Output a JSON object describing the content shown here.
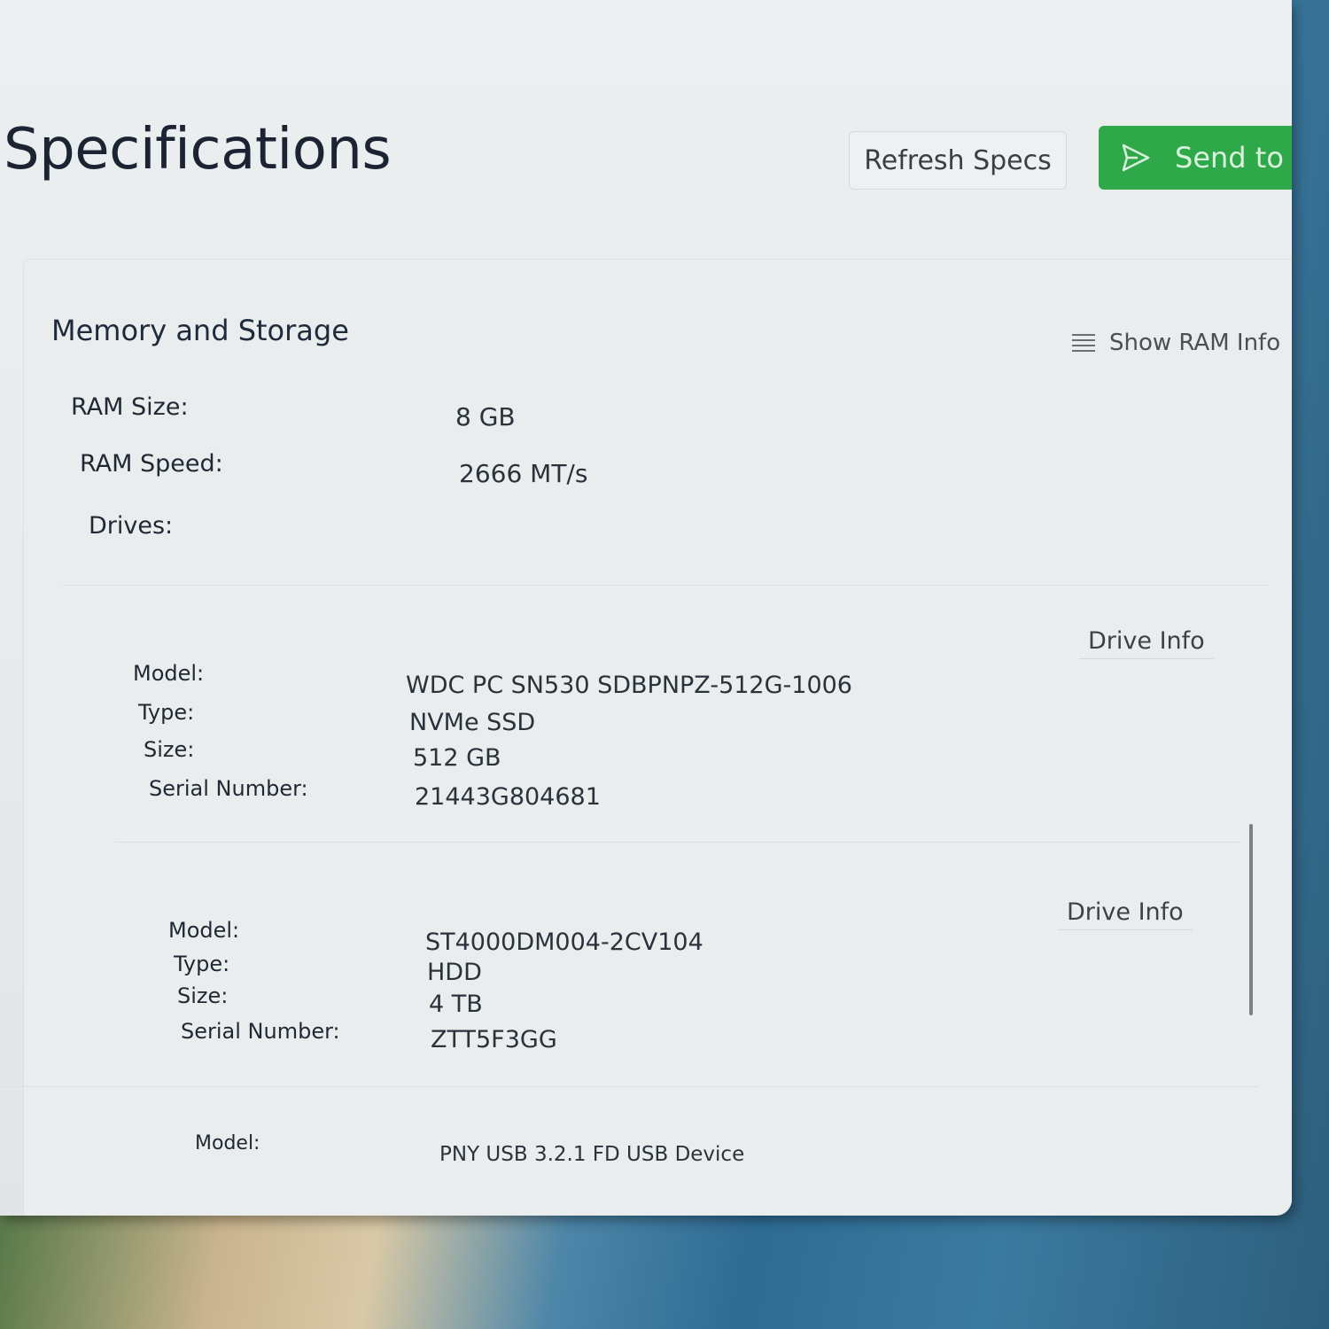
{
  "header": {
    "title": "Specifications",
    "refresh_label": "Refresh Specs",
    "send_label": "Send to PO",
    "send_icon": "send-icon"
  },
  "memory_storage": {
    "section_title": "Memory and Storage",
    "ram_info_label": "Show RAM Info",
    "ram_info_icon": "list-icon",
    "ram_size_label": "RAM Size:",
    "ram_size_value": "8 GB",
    "ram_speed_label": "RAM Speed:",
    "ram_speed_value": "2666 MT/s",
    "drives_label": "Drives:"
  },
  "drives": [
    {
      "model_label": "Model:",
      "model": "WDC PC SN530 SDBPNPZ-512G-1006",
      "type_label": "Type:",
      "type": "NVMe SSD",
      "size_label": "Size:",
      "size": "512 GB",
      "serial_label": "Serial Number:",
      "serial": "21443G804681",
      "info_label": "Drive Info"
    },
    {
      "model_label": "Model:",
      "model": "ST4000DM004-2CV104",
      "type_label": "Type:",
      "type": "HDD",
      "size_label": "Size:",
      "size": "4 TB",
      "serial_label": "Serial Number:",
      "serial": "ZTT5F3GG",
      "info_label": "Drive Info"
    },
    {
      "model_label": "Model:",
      "model": "PNY USB 3.2.1 FD USB Device"
    }
  ],
  "colors": {
    "accent_green": "#2fa84a",
    "window_bg": "#eceff0"
  }
}
